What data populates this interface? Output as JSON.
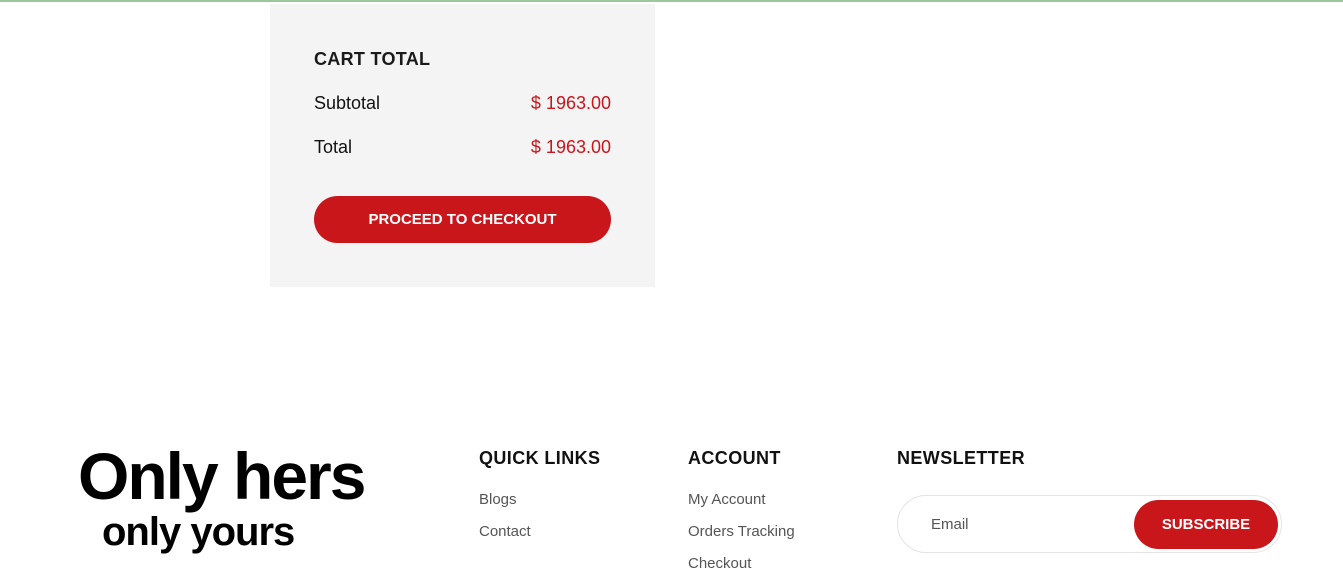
{
  "cart": {
    "title": "CART TOTAL",
    "subtotal_label": "Subtotal",
    "subtotal_value": "$ 1963.00",
    "total_label": "Total",
    "total_value": "$ 1963.00",
    "checkout_label": "PROCEED TO CHECKOUT"
  },
  "brand": {
    "line1": "Only hers",
    "line2": "only yours"
  },
  "footer": {
    "quick_links": {
      "heading": "QUICK LINKS",
      "items": [
        "Blogs",
        "Contact"
      ]
    },
    "account": {
      "heading": "ACCOUNT",
      "items": [
        "My Account",
        "Orders Tracking",
        "Checkout"
      ]
    },
    "newsletter": {
      "heading": "NEWSLETTER",
      "email_placeholder": "Email",
      "subscribe_label": "SUBSCRIBE"
    }
  },
  "colors": {
    "accent": "#c8161b",
    "panel_bg": "#f4f4f4"
  }
}
